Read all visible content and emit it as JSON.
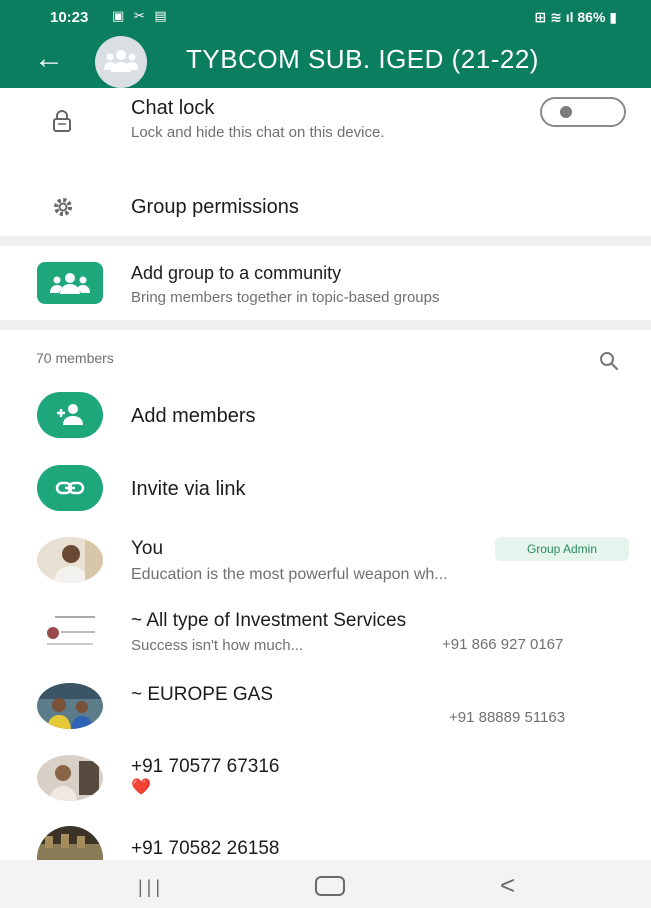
{
  "status_bar": {
    "time": "10:23",
    "left_icons": "▣ ✂ ▤",
    "battery": "86%"
  },
  "header": {
    "title": "TYBCOM  SUB. IGED (21-22)"
  },
  "settings": {
    "chat_lock": {
      "title": "Chat lock",
      "subtitle": "Lock and hide this chat on this device.",
      "enabled": false
    },
    "group_permissions": {
      "title": "Group permissions"
    },
    "community": {
      "title": "Add group to a community",
      "subtitle": "Bring members together in topic-based groups"
    }
  },
  "members": {
    "count_label": "70 members",
    "add_members_label": "Add members",
    "invite_label": "Invite via link",
    "list": [
      {
        "name": "You",
        "status": "Education is the most powerful weapon wh...",
        "badge": "Group Admin",
        "phone": ""
      },
      {
        "name": "~ All type of Investment Services",
        "status": "Success isn't how much...",
        "badge": "",
        "phone": "+91 866 927 0167"
      },
      {
        "name": "~ EUROPE GAS",
        "status": "",
        "badge": "",
        "phone": "+91 88889 51163"
      },
      {
        "name": "+91 70577 67316",
        "status": "❤️",
        "badge": "",
        "phone": ""
      },
      {
        "name": "+91 70582 26158",
        "status": "",
        "badge": "",
        "phone": ""
      }
    ]
  },
  "colors": {
    "header": "#0a7e5e",
    "accent": "#1fa77c",
    "admin_badge_bg": "#e5f4ec"
  },
  "icons": {
    "back": "arrow-left-icon",
    "lock": "lock-icon",
    "permissions": "gear-icon",
    "community": "community-icon",
    "search": "search-icon",
    "add_member": "add-person-icon",
    "invite": "link-icon"
  }
}
